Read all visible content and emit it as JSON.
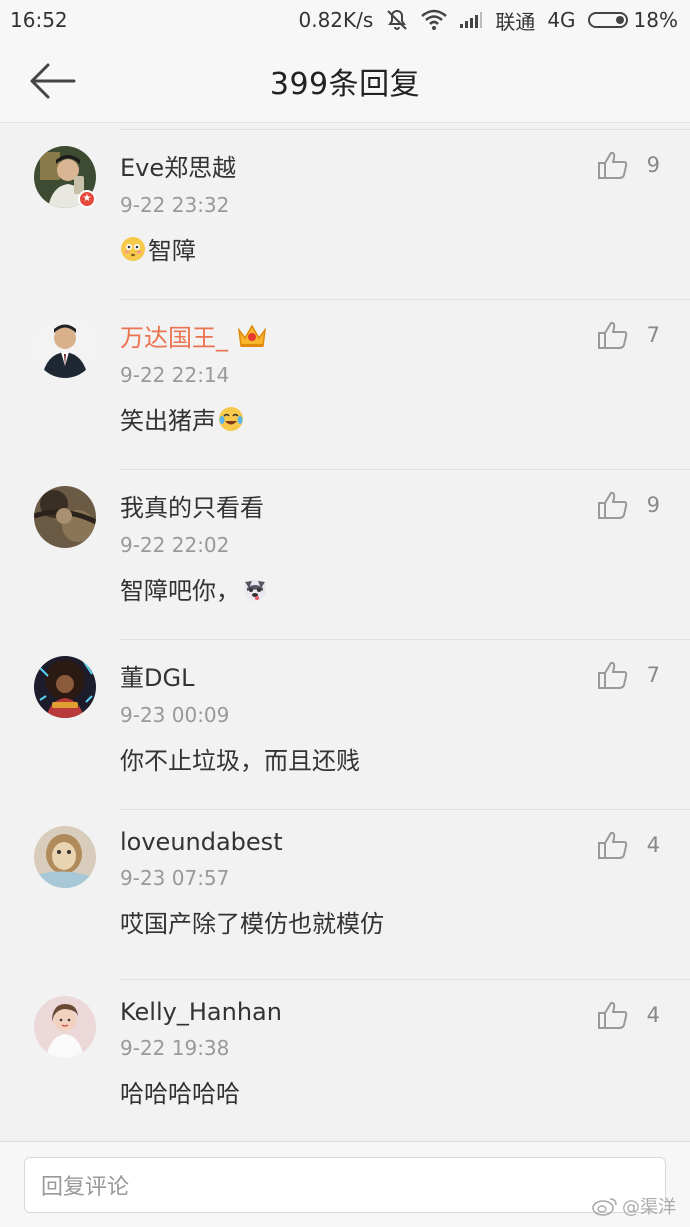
{
  "status_bar": {
    "time": "16:52",
    "speed": "0.82K/s",
    "carrier": "联通",
    "network": "4G",
    "battery": "18%"
  },
  "header": {
    "title": "399条回复",
    "back_icon": "back-arrow-icon"
  },
  "comments": [
    {
      "user": "Eve郑思越",
      "time": "9-22 23:32",
      "text": "智障",
      "likes": "9",
      "emoji_before": "flushed-face-emoji",
      "avatar_color": "#4a5a3a",
      "badge": true
    },
    {
      "user": "万达国王_",
      "time": "9-22 22:14",
      "text": "笑出猪声",
      "likes": "7",
      "emoji_after": "crying-laughing-emoji",
      "vip": true,
      "avatar_color": "#2b2b2b"
    },
    {
      "user": "我真的只看看",
      "time": "9-22 22:02",
      "text": "智障吧你，",
      "likes": "9",
      "emoji_after": "husky-dog-emoji",
      "avatar_color": "#5a4a3a"
    },
    {
      "user": "董DGL",
      "time": "9-23 00:09",
      "text": "你不止垃圾，而且还贱",
      "likes": "7",
      "avatar_color": "#1e1e2a"
    },
    {
      "user": "loveundabest",
      "time": "9-23 07:57",
      "text": "哎国产除了模仿也就模仿",
      "likes": "4",
      "avatar_color": "#c9b7a0"
    },
    {
      "user": "Kelly_Hanhan",
      "time": "9-22 19:38",
      "text": "哈哈哈哈哈",
      "likes": "4",
      "avatar_color": "#e8c8c8"
    }
  ],
  "reply_bar": {
    "placeholder": "回复评论"
  },
  "watermark": {
    "text": "@渠洋"
  }
}
